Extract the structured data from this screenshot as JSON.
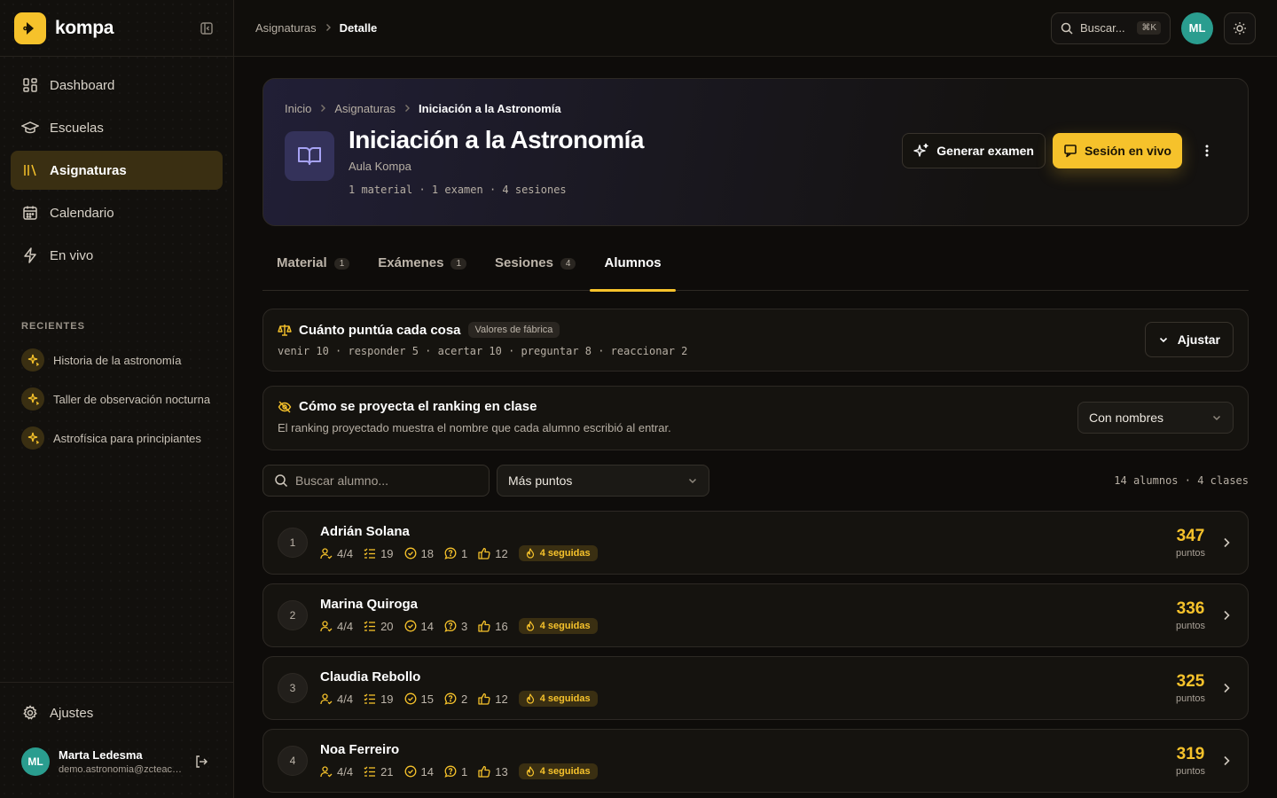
{
  "app": {
    "brand": "kompa"
  },
  "sidebar": {
    "nav": [
      {
        "label": "Dashboard",
        "icon": "dashboard-icon"
      },
      {
        "label": "Escuelas",
        "icon": "graduation-cap-icon"
      },
      {
        "label": "Asignaturas",
        "icon": "library-icon",
        "active": true
      },
      {
        "label": "Calendario",
        "icon": "calendar-icon"
      },
      {
        "label": "En vivo",
        "icon": "bolt-icon"
      }
    ],
    "recent_label": "RECIENTES",
    "recent": [
      {
        "label": "Historia de la astronomía"
      },
      {
        "label": "Taller de observación nocturna"
      },
      {
        "label": "Astrofísica para principiantes"
      }
    ],
    "settings_label": "Ajustes",
    "user": {
      "initials": "ML",
      "name": "Marta Ledesma",
      "email": "demo.astronomia@zcteacher.com"
    }
  },
  "topbar": {
    "breadcrumb": [
      "Asignaturas",
      "Detalle"
    ],
    "search_label": "Buscar...",
    "search_shortcut": "⌘K",
    "avatar_initials": "ML"
  },
  "hero": {
    "breadcrumb": [
      "Inicio",
      "Asignaturas",
      "Iniciación a la Astronomía"
    ],
    "title": "Iniciación a la Astronomía",
    "subtitle": "Aula Kompa",
    "meta": "1 material · 1 examen · 4 sesiones",
    "generate_exam": "Generar examen",
    "live_session": "Sesión en vivo",
    "accent_color": "#f6c22b"
  },
  "tabs": [
    {
      "label": "Material",
      "count": "1"
    },
    {
      "label": "Exámenes",
      "count": "1"
    },
    {
      "label": "Sesiones",
      "count": "4"
    },
    {
      "label": "Alumnos",
      "count": "",
      "active": true
    }
  ],
  "points": {
    "title": "Cuánto puntúa cada cosa",
    "tag": "Valores de fábrica",
    "line": "venir 10 · responder 5 · acertar 10 · preguntar 8 · reaccionar 2",
    "adjust": "Ajustar"
  },
  "projection": {
    "title": "Cómo se proyecta el ranking en clase",
    "description": "El ranking proyectado muestra el nombre que cada alumno escribió al entrar.",
    "mode": "Con nombres"
  },
  "filters": {
    "search_placeholder": "Buscar alumno...",
    "sort": "Más puntos",
    "counts": "14 alumnos · 4 clases"
  },
  "students": [
    {
      "rank": "1",
      "name": "Adrián Solana",
      "attendance": "4/4",
      "answers": "19",
      "correct": "18",
      "questions": "1",
      "reactions": "12",
      "streak": "4 seguidas",
      "points": "347",
      "points_label": "puntos"
    },
    {
      "rank": "2",
      "name": "Marina Quiroga",
      "attendance": "4/4",
      "answers": "20",
      "correct": "14",
      "questions": "3",
      "reactions": "16",
      "streak": "4 seguidas",
      "points": "336",
      "points_label": "puntos"
    },
    {
      "rank": "3",
      "name": "Claudia Rebollo",
      "attendance": "4/4",
      "answers": "19",
      "correct": "15",
      "questions": "2",
      "reactions": "12",
      "streak": "4 seguidas",
      "points": "325",
      "points_label": "puntos"
    },
    {
      "rank": "4",
      "name": "Noa Ferreiro",
      "attendance": "4/4",
      "answers": "21",
      "correct": "14",
      "questions": "1",
      "reactions": "13",
      "streak": "4 seguidas",
      "points": "319",
      "points_label": "puntos"
    }
  ]
}
